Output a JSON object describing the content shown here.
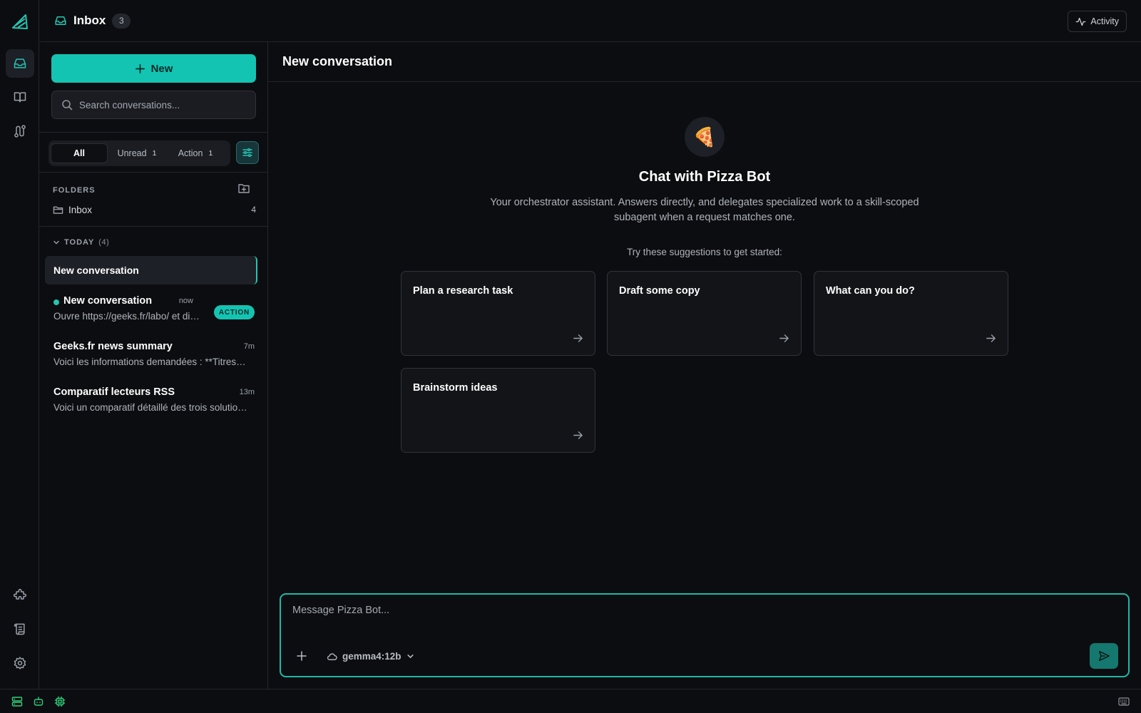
{
  "app": {
    "accent": "#14c4b2"
  },
  "rail": {
    "items": [
      {
        "name": "inbox-icon",
        "active": true
      },
      {
        "name": "book-icon",
        "active": false
      },
      {
        "name": "route-icon",
        "active": false
      },
      {
        "name": "puzzle-icon",
        "active": false
      },
      {
        "name": "scroll-icon",
        "active": false
      },
      {
        "name": "gear-icon",
        "active": false
      }
    ]
  },
  "header": {
    "title": "Inbox",
    "count": "3",
    "activity_label": "Activity"
  },
  "sidebar": {
    "new_label": "New",
    "search_placeholder": "Search conversations...",
    "filters": [
      {
        "label": "All",
        "count": ""
      },
      {
        "label": "Unread",
        "count": "1"
      },
      {
        "label": "Action",
        "count": "1"
      }
    ],
    "folders_heading": "FOLDERS",
    "folders": [
      {
        "label": "Inbox",
        "count": "4"
      }
    ],
    "group": {
      "label": "TODAY",
      "count": "(4)"
    },
    "conversations": [
      {
        "title": "New conversation",
        "selected": true
      },
      {
        "title": "New conversation",
        "preview": "Ouvre https://geeks.fr/labo/ et dis-moi ce qu'il y a",
        "time": "now",
        "badge": "ACTION",
        "unread": true
      },
      {
        "title": "Geeks.fr news summary",
        "preview": "Voici les informations demandées : **Titres des articles**",
        "time": "7m"
      },
      {
        "title": "Comparatif lecteurs RSS",
        "preview": "Voici un comparatif détaillé des trois solutions",
        "time": "13m"
      }
    ]
  },
  "main": {
    "title": "New conversation",
    "bot_emoji": "🍕",
    "bot_title": "Chat with Pizza Bot",
    "bot_description": "Your orchestrator assistant. Answers directly, and delegates specialized work to a skill-scoped subagent when a request matches one.",
    "suggestions_heading": "Try these suggestions to get started:",
    "suggestions": [
      "Plan a research task",
      "Draft some copy",
      "What can you do?",
      "Brainstorm ideas"
    ]
  },
  "composer": {
    "placeholder": "Message Pizza Bot...",
    "model": "gemma4:12b"
  },
  "statusbar": {
    "icons": [
      "server-icon",
      "bot-icon",
      "chip-icon",
      "keyboard-icon"
    ]
  }
}
